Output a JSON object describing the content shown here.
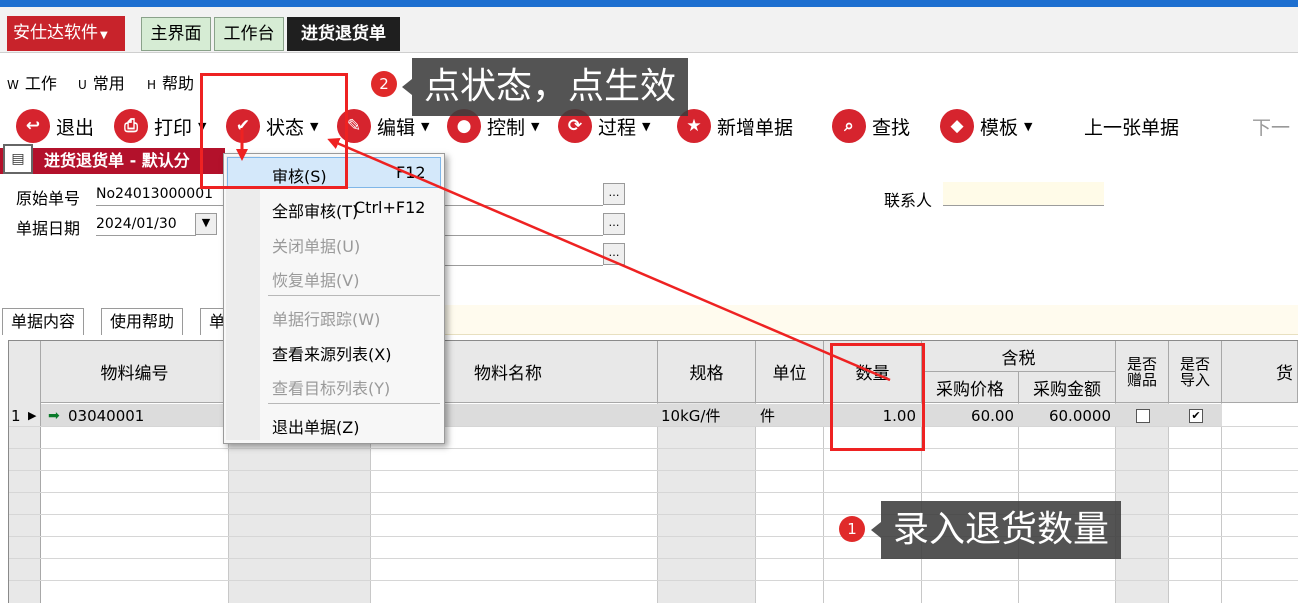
{
  "app": {
    "brand": "安仕达软件",
    "tabs": [
      "主界面",
      "工作台",
      "进货退货单"
    ]
  },
  "menu": [
    {
      "key": "W",
      "label": "工作"
    },
    {
      "key": "U",
      "label": "常用"
    },
    {
      "key": "H",
      "label": "帮助"
    }
  ],
  "toolbar": {
    "exit": "退出",
    "print": "打印",
    "status": "状态",
    "edit": "编辑",
    "control": "控制",
    "process": "过程",
    "new_bill": "新增单据",
    "find": "查找",
    "template": "模板",
    "prev_bill": "上一张单据",
    "next_bill": "下一"
  },
  "section": {
    "title": "进货退货单 - 默认分"
  },
  "form": {
    "original_no_label": "原始单号",
    "original_no_value": "No24013000001",
    "date_label": "单据日期",
    "date_value": "2024/01/30",
    "contact_label": "联系人"
  },
  "content_tabs": [
    "单据内容",
    "使用帮助",
    "单"
  ],
  "grid": {
    "headers": {
      "code": "物料编号",
      "name": "物料名称",
      "spec": "规格",
      "unit": "单位",
      "qty": "数量",
      "tax_group": "含税",
      "price": "采购价格",
      "amount": "采购金额",
      "gift": "是否赠品",
      "import": "是否导入",
      "last": "货"
    },
    "rows": [
      {
        "no": "1",
        "code": "03040001",
        "spec": "10kG/件",
        "unit": "件",
        "qty": "1.00",
        "price": "60.00",
        "amount": "60.0000",
        "gift": false,
        "import": true
      }
    ]
  },
  "context_menu": {
    "items": [
      {
        "label": "审核(S)",
        "shortcut": "F12"
      },
      {
        "label": "全部审核(T)",
        "shortcut": "Ctrl+F12"
      },
      {
        "label": "关闭单据(U)"
      },
      {
        "label": "恢复单据(V)"
      },
      {
        "label": "单据行跟踪(W)"
      },
      {
        "label": "查看来源列表(X)"
      },
      {
        "label": "查看目标列表(Y)"
      },
      {
        "label": "退出单据(Z)"
      }
    ]
  },
  "annotations": {
    "step1_num": "1",
    "step1_text": "录入退货数量",
    "step2_num": "2",
    "step2_text": "点状态，点生效"
  },
  "colors": {
    "accent_red": "#c8232b",
    "highlight_red": "#ee2222",
    "tab_green": "#d6ecd4",
    "title_blue": "#1e6fd0"
  }
}
